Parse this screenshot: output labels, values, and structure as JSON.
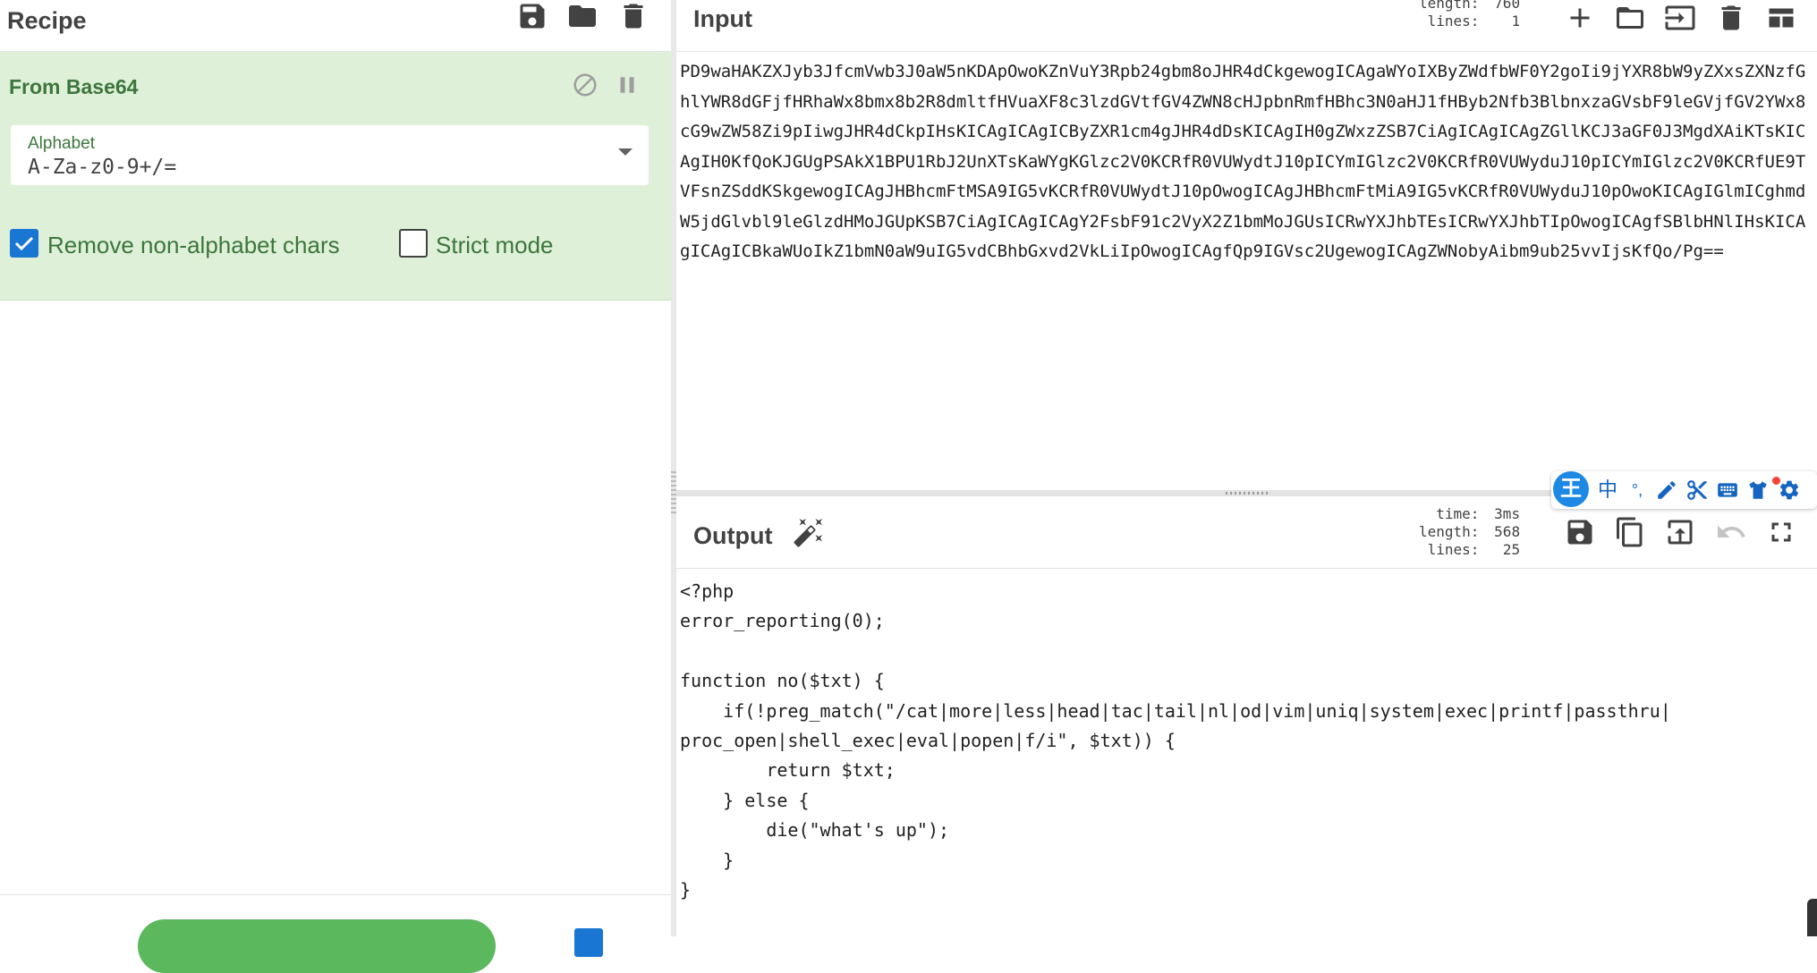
{
  "recipe": {
    "title": "Recipe",
    "operation": {
      "name": "From Base64",
      "alphabet_label": "Alphabet",
      "alphabet_value": "A-Za-z0-9+/=",
      "remove_non_alphabet_label": "Remove non-alphabet chars",
      "remove_non_alphabet_checked": true,
      "strict_mode_label": "Strict mode",
      "strict_mode_checked": false
    }
  },
  "input": {
    "title": "Input",
    "length_label": "length:",
    "length_value": "760",
    "lines_label": "lines:",
    "lines_value": "1",
    "text": "PD9waHAKZXJyb3JfcmVwb3J0aW5nKDApOwoKZnVuY3Rpb24gbm8oJHR4dCkgewogICAgaWYoIXByZWdfbWF0Y2goIi9jYXR8bW9yZXxsZXNzfGhlYWR8dGFjfHRhaWx8bmx8b2R8dmltfHVuaXF8c3lzdGVtfGV4ZWN8cHJpbnRmfHBhc3N0aHJ1fHByb2Nfb3BlbnxzaGVsbF9leGVjfGV2YWx8cG9wZW58Zi9pIiwgJHR4dCkpIHsKICAgICAgICByZXR1cm4gJHR4dDsKICAgIH0gZWxzZSB7CiAgICAgICAgZGllKCJ3aGF0J3MgdXAiKTsKICAgIH0KfQoKJGUgPSAkX1BPU1RbJ2UnXTsKaWYgKGlzc2V0KCRfR0VUWydtJ10pICYmIGlzc2V0KCRfR0VUWyduJ10pICYmIGlzc2V0KCRfUE9TVFsnZSddKSkgewogICAgJHBhcmFtMSA9IG5vKCRfR0VUWydtJ10pOwogICAgJHBhcmFtMiA9IG5vKCRfR0VUWyduJ10pOwoKICAgIGlmICghmdW5jdGlvbl9leGlzdHMoJGUpKSB7CiAgICAgICAgY2FsbF91c2VyX2Z1bmMoJGUsICRwYXJhbTEsICRwYXJhbTIpOwogICAgfSBlbHNlIHsKICAgICAgICBkaWUoIkZ1bmN0aW9uIG5vdCBhbGxvd2VkLiIpOwogICAgfQp9IGVsc2UgewogICAgZWNobyAibm9ub25vvIjsKfQo/Pg=="
  },
  "output": {
    "title": "Output",
    "time_label": "time:",
    "time_value": "3ms",
    "length_label": "length:",
    "length_value": "568",
    "lines_label": "lines:",
    "lines_value": "25",
    "text": "<?php\nerror_reporting(0);\n\nfunction no($txt) {\n    if(!preg_match(\"/cat|more|less|head|tac|tail|nl|od|vim|uniq|system|exec|printf|passthru|\nproc_open|shell_exec|eval|popen|f/i\", $txt)) {\n        return $txt;\n    } else {\n        die(\"what's up\");\n    }\n}"
  },
  "ime": {
    "logo": "王",
    "lang": "中",
    "punct": "°,"
  },
  "icons": {
    "save": "save-icon",
    "open": "folder-icon",
    "delete": "trash-icon",
    "add": "plus-icon",
    "disable": "disable-icon",
    "pause": "pause-icon",
    "magic": "magic-wand-icon",
    "copy": "copy-icon",
    "replace_input": "replace-input-icon",
    "undo": "undo-icon",
    "maximise": "fullscreen-icon",
    "layout": "layout-icon"
  }
}
